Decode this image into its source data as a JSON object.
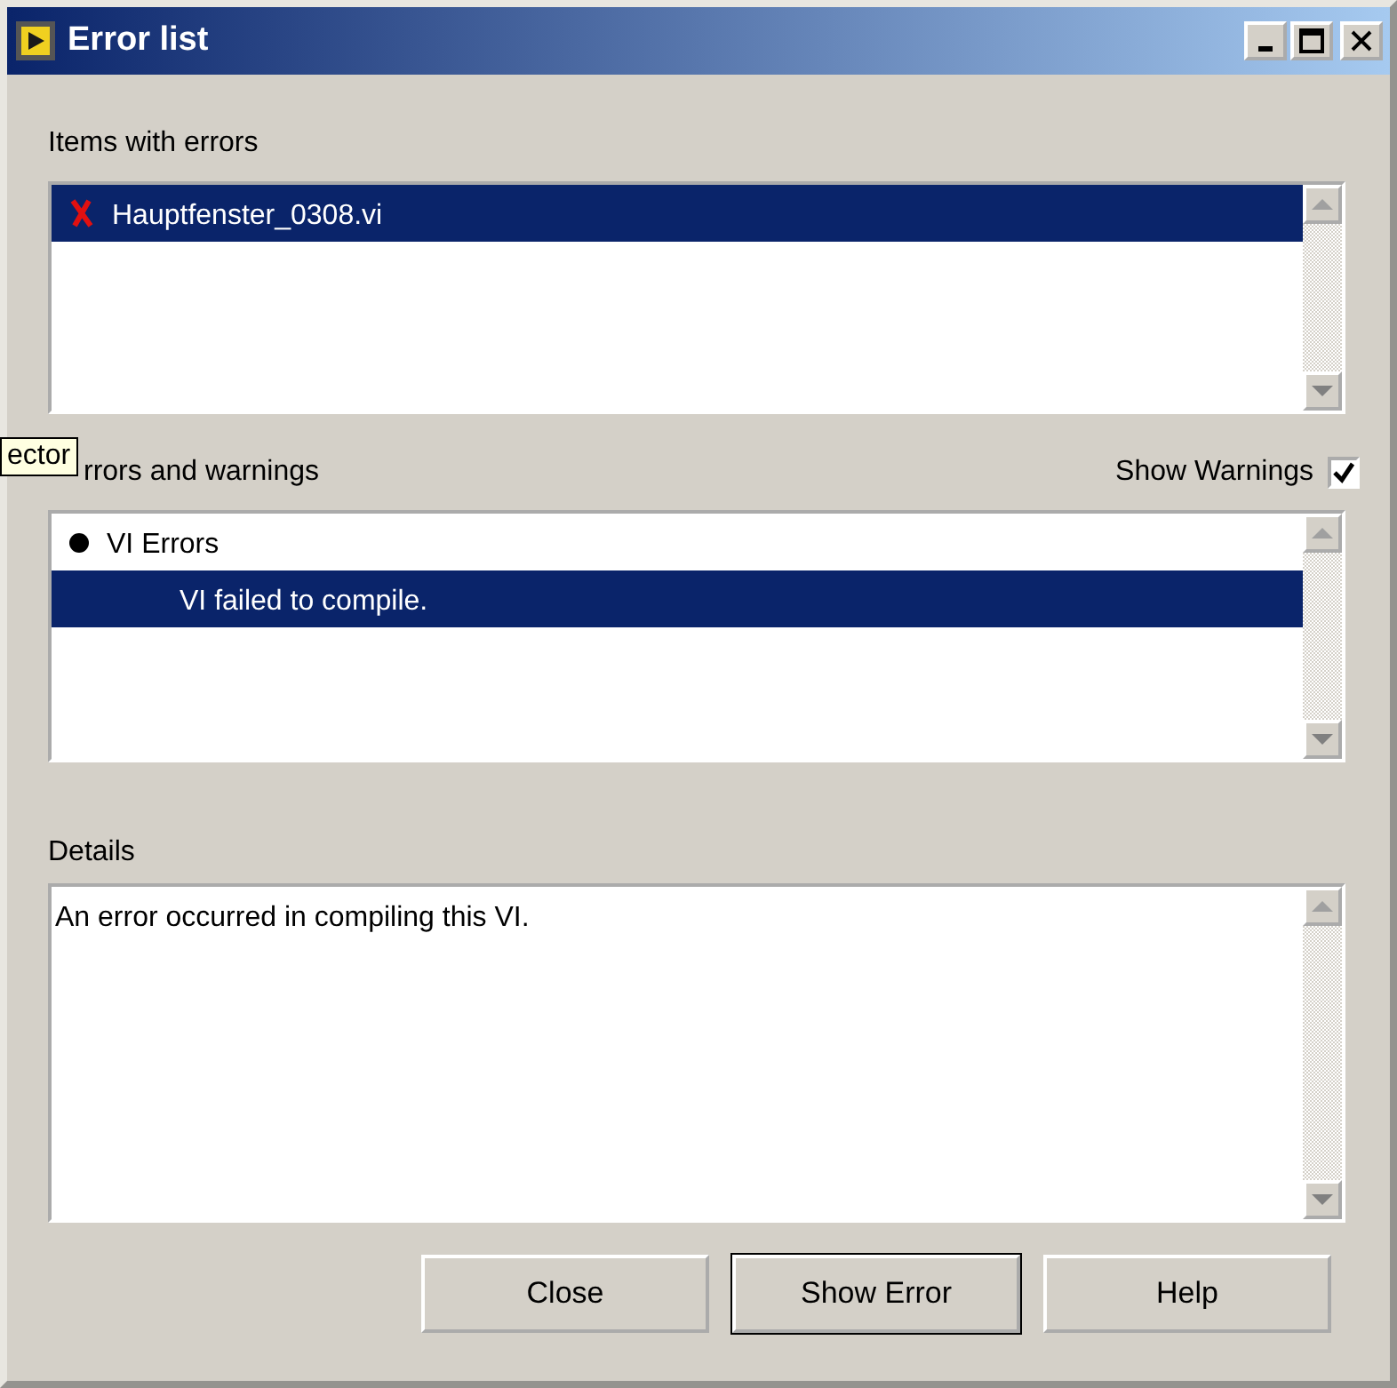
{
  "window": {
    "title": "Error list"
  },
  "items_with_errors": {
    "label": "Items with errors",
    "items": [
      {
        "text": "Hauptfenster_0308.vi",
        "selected": true
      }
    ]
  },
  "tooltip": "ector",
  "errors_and_warnings": {
    "label": "rrors and warnings",
    "show_warnings": {
      "label": "Show Warnings",
      "checked": true
    },
    "items": [
      {
        "kind": "group",
        "text": "VI Errors",
        "selected": false
      },
      {
        "kind": "entry",
        "text": "VI failed to compile.",
        "selected": true
      }
    ]
  },
  "details": {
    "label": "Details",
    "text": "An error occurred in compiling this VI."
  },
  "buttons": [
    {
      "label": "Close",
      "default": false
    },
    {
      "label": "Show Error",
      "default": true
    },
    {
      "label": "Help",
      "default": false
    }
  ]
}
